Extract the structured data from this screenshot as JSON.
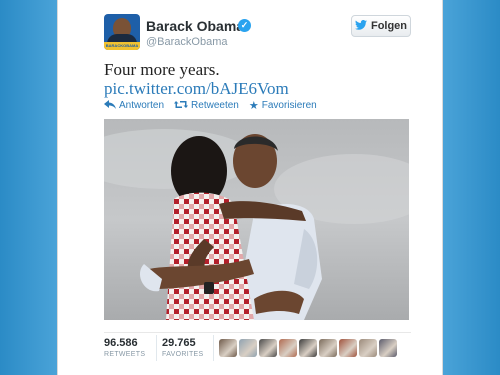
{
  "profile": {
    "name": "Barack Obama",
    "handle": "@BarackObama",
    "avatar_band_text": "BARACKOBAMA",
    "verified_icon": "verified-badge-icon"
  },
  "follow_button": {
    "label": "Folgen",
    "icon": "twitter-bird-icon"
  },
  "tweet": {
    "text": "Four more years.",
    "link": "pic.twitter.com/bAJE6Vom"
  },
  "actions": [
    {
      "label": "Antworten",
      "icon": "reply-icon"
    },
    {
      "label": "Retweeten",
      "icon": "retweet-icon"
    },
    {
      "label": "Favorisieren",
      "icon": "star-icon"
    }
  ],
  "stats": {
    "retweets": {
      "value": "96.586",
      "label": "RETWEETS"
    },
    "favorites": {
      "value": "29.765",
      "label": "FAVORITES"
    }
  },
  "favoriters": [
    {
      "color": "#6e5a4a"
    },
    {
      "color": "#8fa2b0"
    },
    {
      "color": "#4a4a4a"
    },
    {
      "color": "#b06a50"
    },
    {
      "color": "#3c3c3c"
    },
    {
      "color": "#7b6b5b"
    },
    {
      "color": "#a0523c"
    },
    {
      "color": "#9b8a7a"
    },
    {
      "color": "#5b5b6b"
    }
  ],
  "colors": {
    "link": "#2b7bb9",
    "background": "#5aa9d6",
    "verified": "#2aa3ef"
  }
}
